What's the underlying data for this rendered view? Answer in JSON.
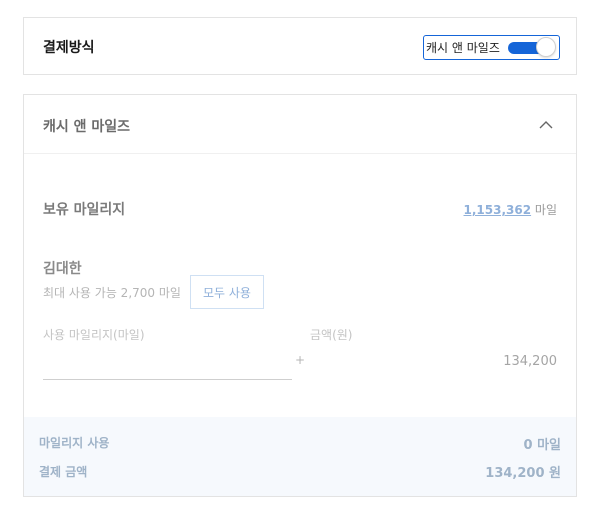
{
  "payment": {
    "title": "결제방식",
    "method_label": "캐시 앤 마일즈",
    "toggle_on": true,
    "accent_color": "#1565d8"
  },
  "mileage_section": {
    "title": "캐시 앤 마일즈",
    "collapse_icon": "chevron-up-icon",
    "balance_label": "보유 마일리지",
    "balance_value": "1,153,362",
    "balance_unit": "마일",
    "member_name": "김대한",
    "max_usable": "최대 사용 가능 2,700 마일",
    "use_all_label": "모두 사용",
    "mileage_input_label": "사용 마일리지(마일)",
    "mileage_input_value": "",
    "plus_sign": "+",
    "amount_label": "금액(원)",
    "amount_value": "134,200"
  },
  "summary": {
    "usage_label": "마일리지 사용",
    "usage_value": "0 마일",
    "total_label": "결제 금액",
    "total_value": "134,200 원"
  }
}
